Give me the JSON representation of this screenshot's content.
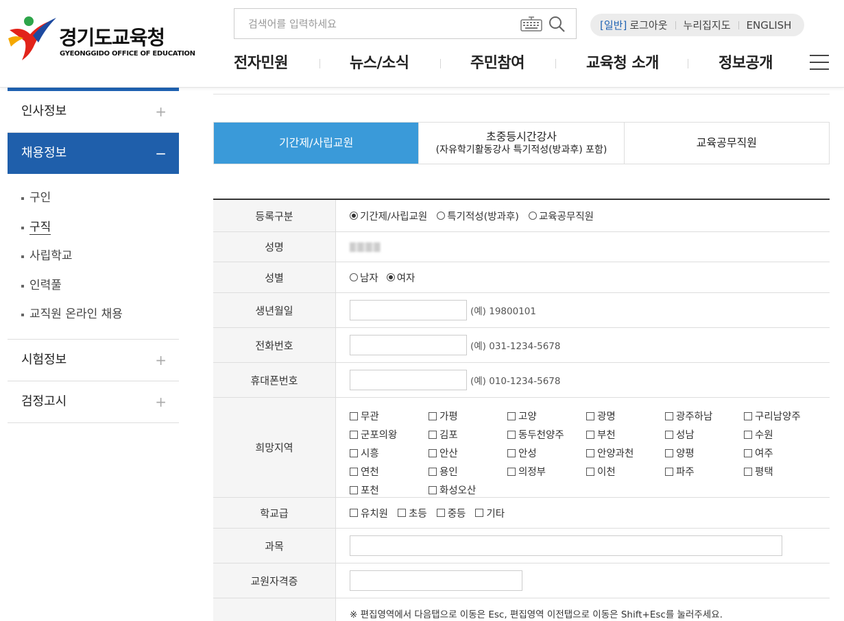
{
  "header": {
    "logo_title": "경기도교육청",
    "logo_sub": "GYEONGGIDO OFFICE OF EDUCATION",
    "search_placeholder": "검색어를 입력하세요",
    "util": {
      "user_type": "[일반]",
      "logout": "로그아웃",
      "map": "누리집지도",
      "english": "ENGLISH"
    },
    "nav": [
      "전자민원",
      "뉴스/소식",
      "주민참여",
      "교육청 소개",
      "정보공개"
    ]
  },
  "sidebar": {
    "menus": [
      {
        "label": "인사정보",
        "toggle": "+"
      },
      {
        "label": "채용정보",
        "toggle": "−"
      },
      {
        "label": "시험정보",
        "toggle": "+"
      },
      {
        "label": "검정고시",
        "toggle": "+"
      }
    ],
    "sub_items": [
      "구인",
      "구직",
      "사립학교",
      "인력풀",
      "교직원 온라인 채용"
    ],
    "current_sub": "구직"
  },
  "tabs": [
    {
      "label": "기간제/사립교원",
      "sub": ""
    },
    {
      "label": "초중등시간강사",
      "sub": "(자유학기활동강사 특기적성(방과후) 포함)"
    },
    {
      "label": "교육공무직원",
      "sub": ""
    }
  ],
  "form": {
    "reg_type": {
      "label": "등록구분",
      "options": [
        "기간제/사립교원",
        "특기적성(방과후)",
        "교육공무직원"
      ],
      "selected": "기간제/사립교원"
    },
    "name": {
      "label": "성명"
    },
    "gender": {
      "label": "성별",
      "options": [
        "남자",
        "여자"
      ],
      "selected": "여자"
    },
    "birth": {
      "label": "생년월일",
      "value": "",
      "hint": "(예) 19800101"
    },
    "phone": {
      "label": "전화번호",
      "value": "",
      "hint": "(예) 031-1234-5678"
    },
    "mobile": {
      "label": "휴대폰번호",
      "value": "",
      "hint": "(예) 010-1234-5678"
    },
    "region": {
      "label": "희망지역",
      "options": [
        "무관",
        "가평",
        "고양",
        "광명",
        "광주하남",
        "구리남양주",
        "군포의왕",
        "김포",
        "동두천양주",
        "부천",
        "성남",
        "수원",
        "시흥",
        "안산",
        "안성",
        "안양과천",
        "양평",
        "여주",
        "연천",
        "용인",
        "의정부",
        "이천",
        "파주",
        "평택",
        "포천",
        "화성오산"
      ]
    },
    "school_level": {
      "label": "학교급",
      "options": [
        "유치원",
        "초등",
        "중등",
        "기타"
      ]
    },
    "subject": {
      "label": "과목",
      "value": ""
    },
    "license": {
      "label": "교원자격증",
      "value": ""
    },
    "notice": "※ 편집영역에서 다음탭으로 이동은 Esc, 편집영역 이전탭으로 이동은 Shift+Esc를 눌러주세요."
  }
}
